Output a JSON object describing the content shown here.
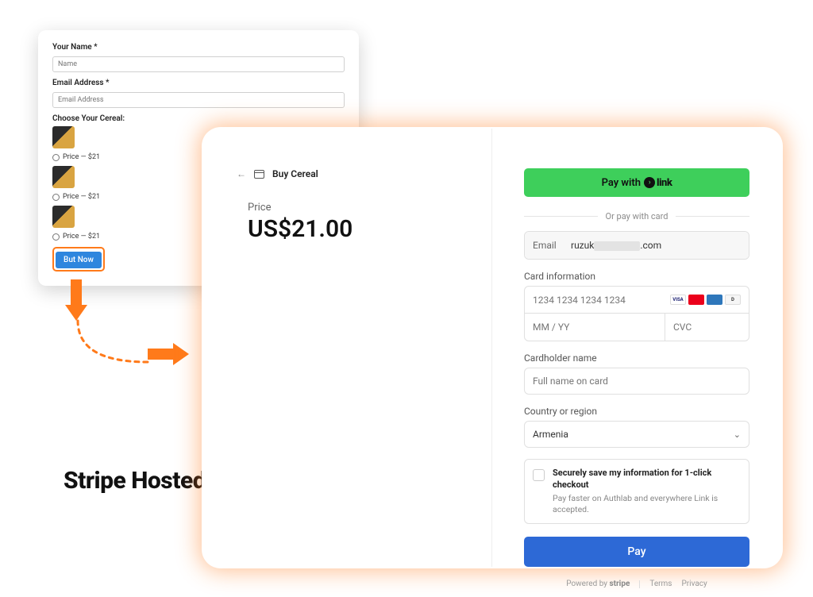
{
  "form": {
    "name_label": "Your Name *",
    "name_placeholder": "Name",
    "email_label": "Email Address *",
    "email_placeholder": "Email Address",
    "choose_label": "Choose Your Cereal:",
    "price_text": "Price  —  $21",
    "button": "But Now"
  },
  "caption": "Stripe Hosted Checkout",
  "checkout": {
    "merchant": "Buy Cereal",
    "price_label": "Price",
    "amount": "US$21.00",
    "link_button_prefix": "Pay with",
    "link_brand": "link",
    "or_text": "Or pay with card",
    "email_label": "Email",
    "email_prefix": "ruzuk",
    "email_suffix": ".com",
    "card_section": "Card information",
    "card_placeholder": "1234 1234 1234 1234",
    "exp_placeholder": "MM / YY",
    "cvc_placeholder": "CVC",
    "name_section": "Cardholder name",
    "name_placeholder": "Full name on card",
    "country_section": "Country or region",
    "country_value": "Armenia",
    "save_title": "Securely save my information for 1-click checkout",
    "save_sub": "Pay faster on Authlab and everywhere Link is accepted.",
    "pay_button": "Pay",
    "powered": "Powered by",
    "stripe": "stripe",
    "terms": "Terms",
    "privacy": "Privacy"
  }
}
